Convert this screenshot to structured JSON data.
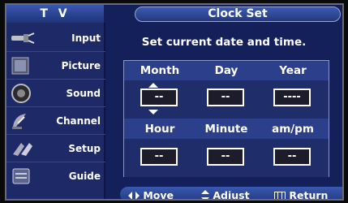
{
  "header": {
    "app_label": "T V",
    "title": "Clock Set"
  },
  "sidebar": {
    "items": [
      {
        "label": "Input",
        "icon": "input-plug-icon"
      },
      {
        "label": "Picture",
        "icon": "picture-frame-icon"
      },
      {
        "label": "Sound",
        "icon": "speaker-icon"
      },
      {
        "label": "Channel",
        "icon": "satellite-dish-icon"
      },
      {
        "label": "Setup",
        "icon": "setup-icon"
      },
      {
        "label": "Guide",
        "icon": "guide-icon"
      }
    ]
  },
  "main": {
    "instruction": "Set current date and time.",
    "date_labels": {
      "month": "Month",
      "day": "Day",
      "year": "Year"
    },
    "date_values": {
      "month": "--",
      "day": "--",
      "year": "----"
    },
    "time_labels": {
      "hour": "Hour",
      "minute": "Minute",
      "ampm": "am/pm"
    },
    "time_values": {
      "hour": "--",
      "minute": "--",
      "ampm": "--"
    },
    "active_field": "month"
  },
  "footer": {
    "move_label": "Move",
    "adjust_label": "Adjust",
    "return_label": "Return"
  },
  "colors": {
    "panel_bg": "#14205a",
    "sidebar_bg": "#1e2a68",
    "accent": "#3a58b2"
  }
}
